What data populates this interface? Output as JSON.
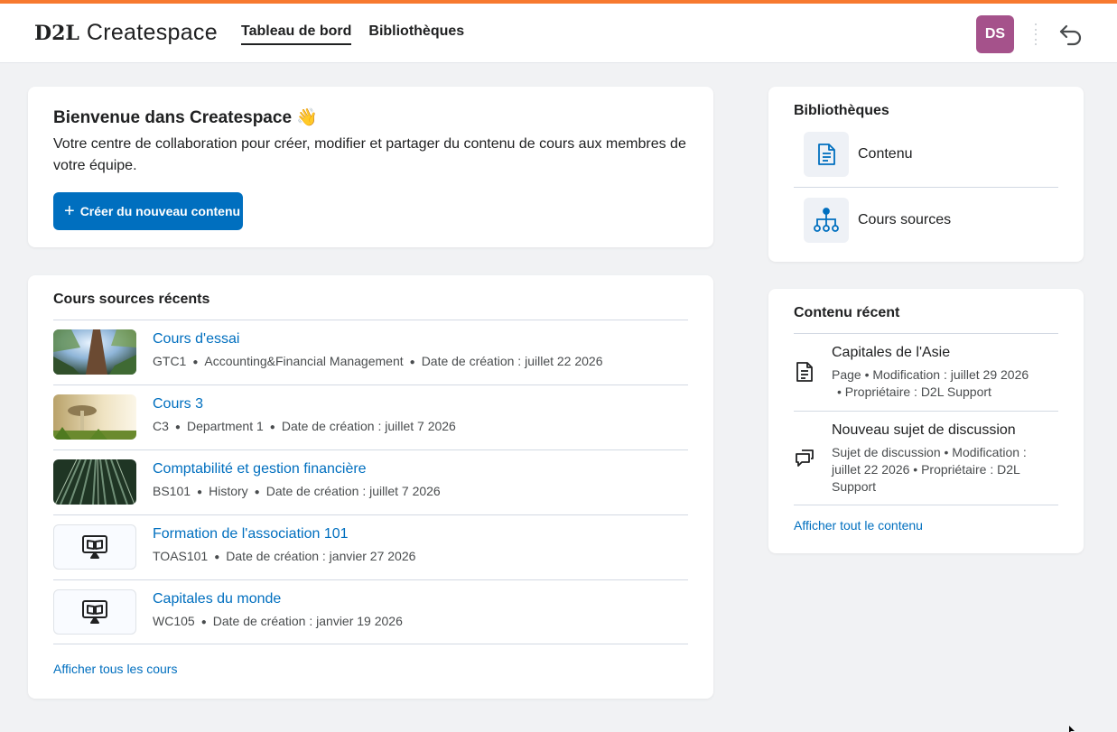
{
  "colors": {
    "accent_bar": "#f7792f",
    "brand_blue": "#006fbf",
    "avatar_bg": "#a5528b"
  },
  "header": {
    "logo_mark": "D2L",
    "logo_product": "Createspace",
    "nav": [
      {
        "label": "Tableau de bord",
        "active": true
      },
      {
        "label": "Bibliothèques",
        "active": false
      }
    ],
    "avatar_initials": "DS",
    "back_icon": "undo-arrow-icon"
  },
  "welcome": {
    "title": "Bienvenue dans Createspace 👋",
    "description": "Votre centre de collaboration pour créer, modifier et partager du contenu de cours aux membres de votre équipe.",
    "create_button": "Créer du nouveau contenu"
  },
  "recent_courses": {
    "title": "Cours sources récents",
    "items": [
      {
        "name": "Cours d'essai",
        "code": "GTC1",
        "department": "Accounting&Financial Management",
        "created": "Date de création : juillet 22 2026",
        "thumb": "forest-tree-photo"
      },
      {
        "name": "Cours 3",
        "code": "C3",
        "department": "Department 1",
        "created": "Date de création : juillet 7 2026",
        "thumb": "mushroom-photo"
      },
      {
        "name": "Comptabilité et gestion financière",
        "code": "BS101",
        "department": "History",
        "created": "Date de création : juillet 7 2026",
        "thumb": "bamboo-forest-photo"
      },
      {
        "name": "Formation de l'association 101",
        "code": "TOAS101",
        "created": "Date de création : janvier 27 2026",
        "thumb": "presentation-book-icon"
      },
      {
        "name": "Capitales du monde",
        "code": "WC105",
        "created": "Date de création : janvier 19 2026",
        "thumb": "presentation-book-icon"
      }
    ],
    "view_all": "Afficher tous les cours"
  },
  "libraries": {
    "title": "Bibliothèques",
    "items": [
      {
        "label": "Contenu",
        "icon": "document-icon"
      },
      {
        "label": "Cours sources",
        "icon": "hierarchy-icon"
      }
    ]
  },
  "recent_content": {
    "title": "Contenu récent",
    "items": [
      {
        "title": "Capitales de l'Asie",
        "meta_line1": "Page  •  Modification : juillet 29 2026",
        "meta_line2": "•  Propriétaire : D2L Support",
        "icon": "page-icon"
      },
      {
        "title": "Nouveau sujet de discussion",
        "meta": "Sujet de discussion  •  Modification : juillet 22 2026  •  Propriétaire : D2L Support",
        "icon": "discussion-icon"
      }
    ],
    "view_all": "Afficher tout le contenu"
  }
}
